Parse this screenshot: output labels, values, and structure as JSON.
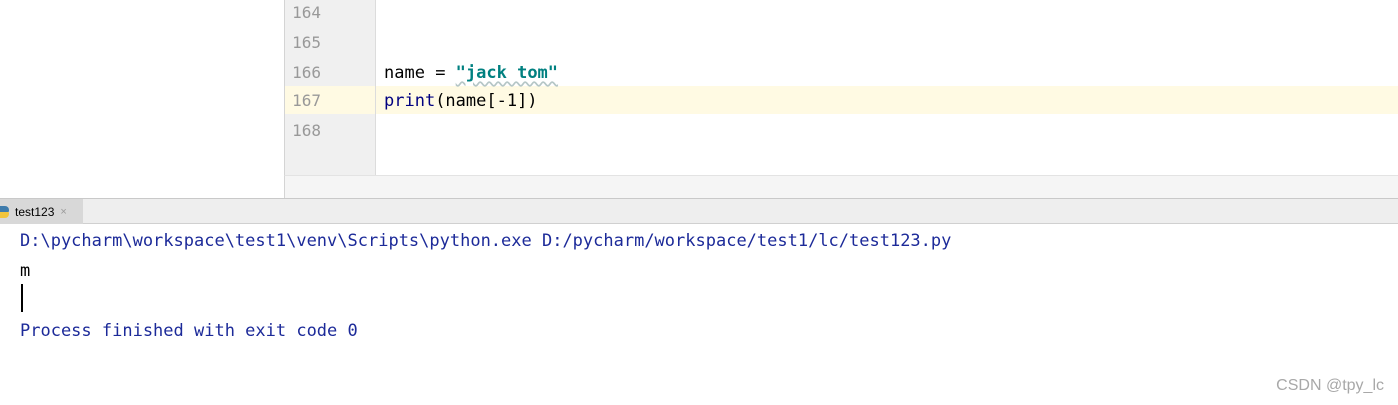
{
  "editor": {
    "lines": [
      {
        "number": "164",
        "code": ""
      },
      {
        "number": "165",
        "code": ""
      },
      {
        "number": "166",
        "code": ""
      },
      {
        "number": "167",
        "code": ""
      },
      {
        "number": "168",
        "code": ""
      }
    ],
    "line166": {
      "var": "name",
      "op": " = ",
      "string": "\"jack tom\""
    },
    "line167": {
      "func": "print",
      "args": "(name[-1])"
    },
    "current_line": "167"
  },
  "run": {
    "tab_label": "test123",
    "tab_close": "×",
    "console": {
      "command": "D:\\pycharm\\workspace\\test1\\venv\\Scripts\\python.exe D:/pycharm/workspace/test1/lc/test123.py",
      "output": "m",
      "exit_message": "Process finished with exit code 0"
    }
  },
  "watermark": "CSDN @tpy_lc",
  "colors": {
    "caret_row": "#fffae3",
    "string_literal": "#008080",
    "console_system": "#1c2a99",
    "gutter_bg": "#f0f0f0"
  }
}
